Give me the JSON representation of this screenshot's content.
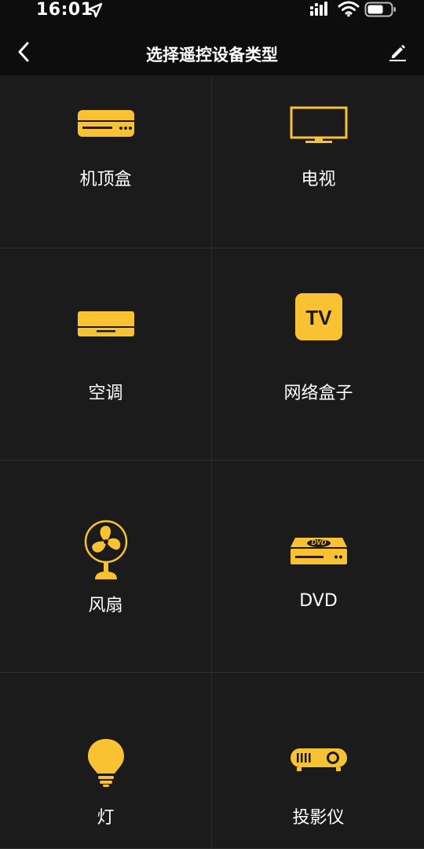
{
  "status_bar": {
    "time": "16:01"
  },
  "nav": {
    "title": "选择遥控设备类型"
  },
  "accent_color": "#F8C233",
  "devices": [
    {
      "label": "机顶盒",
      "icon": "set-top-box-icon"
    },
    {
      "label": "电视",
      "icon": "tv-icon"
    },
    {
      "label": "空调",
      "icon": "air-conditioner-icon"
    },
    {
      "label": "网络盒子",
      "icon": "network-box-icon",
      "icon_text": "TV"
    },
    {
      "label": "风扇",
      "icon": "fan-icon"
    },
    {
      "label": "DVD",
      "icon": "dvd-icon",
      "icon_text": "DVD"
    },
    {
      "label": "灯",
      "icon": "light-bulb-icon"
    },
    {
      "label": "投影仪",
      "icon": "projector-icon"
    }
  ]
}
